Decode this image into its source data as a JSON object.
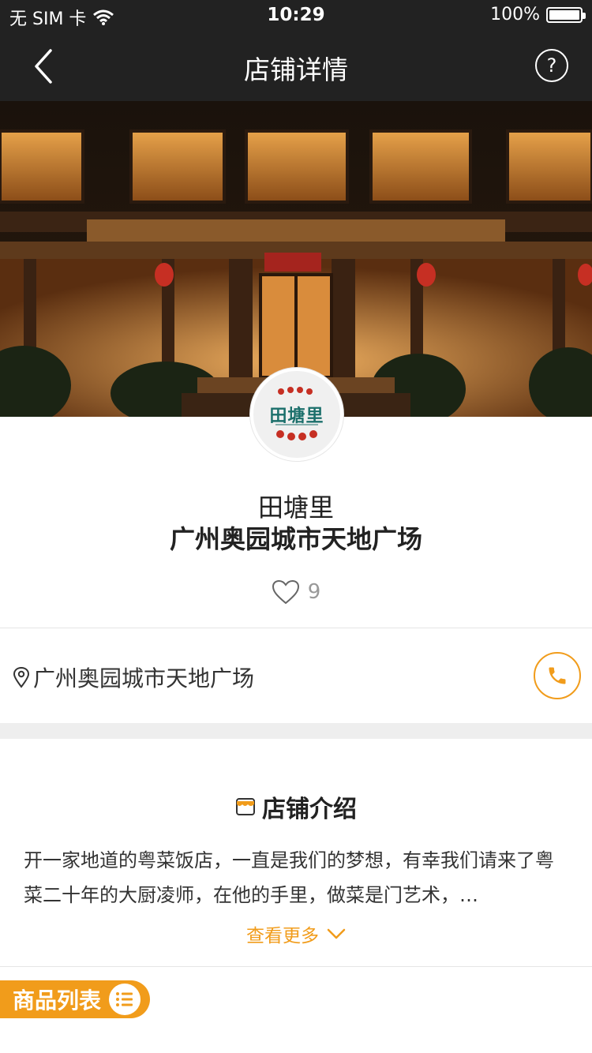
{
  "status_bar": {
    "carrier": "无 SIM 卡",
    "time": "10:29",
    "battery": "100%"
  },
  "nav": {
    "title": "店铺详情",
    "back_icon": "chevron-left-icon",
    "help_icon": "question-circle-icon"
  },
  "store": {
    "logo_text": "田塘里",
    "name_line1": "田塘里",
    "name_line2": "广州奥园城市天地广场",
    "likes": "9",
    "address": "广州奥园城市天地广场"
  },
  "intro": {
    "title": "店铺介绍",
    "text": "开一家地道的粤菜饭店，一直是我们的梦想，有幸我们请来了粤菜二十年的大厨凌师，在他的手里，做菜是门艺术，…",
    "more": "查看更多"
  },
  "products": {
    "tab_label": "商品列表"
  },
  "colors": {
    "accent": "#f19c1b",
    "header": "#222222",
    "logo_teal": "#1b6f6b"
  }
}
